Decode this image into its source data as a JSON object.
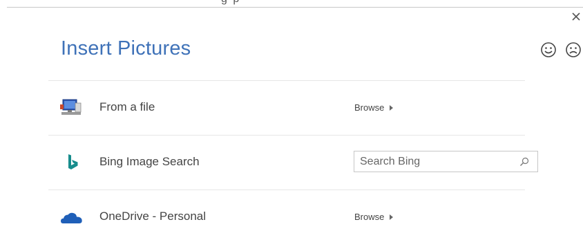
{
  "dialog": {
    "title": "Insert Pictures",
    "top_cut_text": "g  p"
  },
  "sources": [
    {
      "label": "From a file",
      "icon": "computer-file-icon",
      "action": {
        "type": "browse",
        "label": "Browse"
      }
    },
    {
      "label": "Bing Image Search",
      "icon": "bing-logo-icon",
      "action": {
        "type": "search",
        "placeholder": "Search Bing",
        "value": ""
      }
    },
    {
      "label": "OneDrive - Personal",
      "icon": "onedrive-cloud-icon",
      "action": {
        "type": "browse",
        "label": "Browse"
      }
    }
  ],
  "feedback": {
    "happy_icon": "smiley-face-icon",
    "sad_icon": "frown-face-icon"
  },
  "colors": {
    "title": "#3f72b8",
    "bing": "#178c8c",
    "onedrive": "#1f5fb8",
    "divider": "#e6e6e6"
  }
}
